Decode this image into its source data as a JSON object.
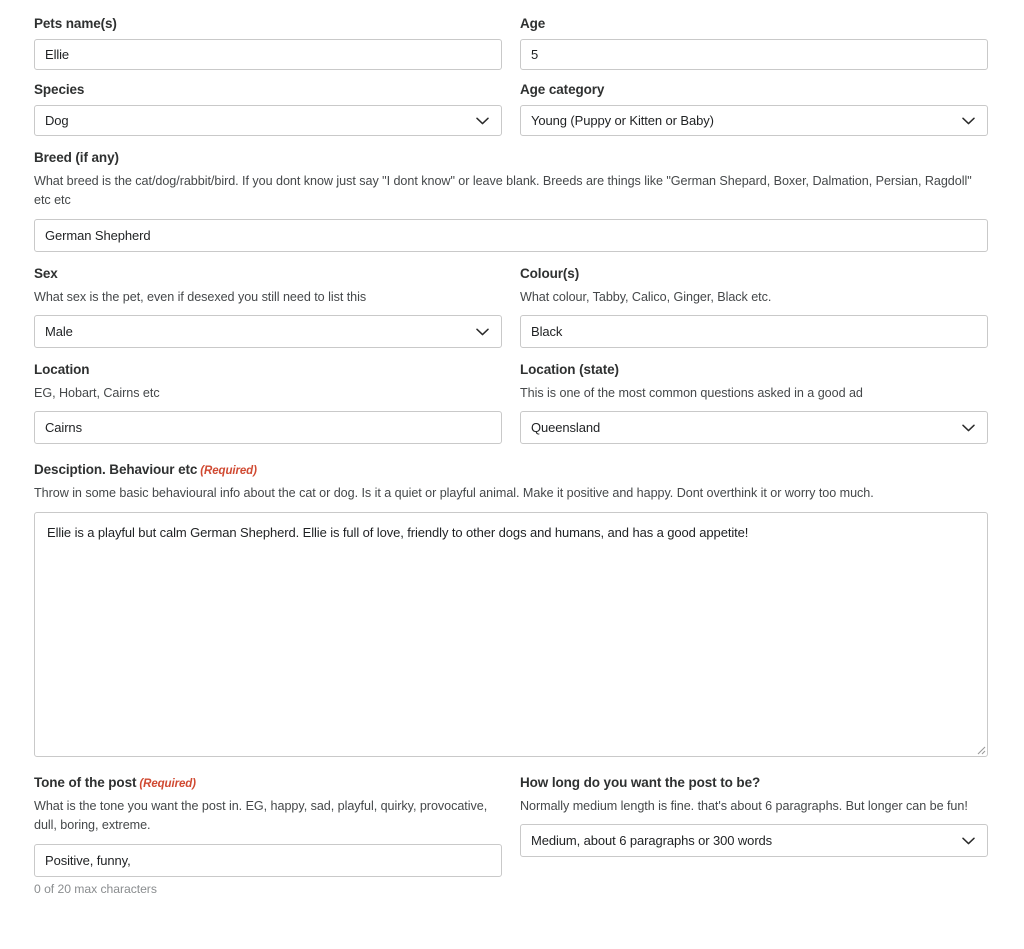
{
  "colors": {
    "required_red": "#d04a32",
    "border": "#c9c9c9",
    "label": "#2f3131",
    "help": "#45484a",
    "counter": "#8a8d8f"
  },
  "form": {
    "pet_name": {
      "label": "Pets name(s)",
      "value": "Ellie"
    },
    "age": {
      "label": "Age",
      "value": "5"
    },
    "species": {
      "label": "Species",
      "value": "Dog"
    },
    "age_category": {
      "label": "Age category",
      "value": "Young (Puppy or Kitten or Baby)"
    },
    "breed": {
      "label": "Breed (if any)",
      "help": "What breed is the cat/dog/rabbit/bird. If you dont know just say \"I dont know\" or leave blank. Breeds are things like \"German Shepard, Boxer, Dalmation, Persian, Ragdoll\" etc etc",
      "value": "German Shepherd"
    },
    "sex": {
      "label": "Sex",
      "help": "What sex is the pet, even if desexed you still need to list this",
      "value": "Male"
    },
    "colour": {
      "label": "Colour(s)",
      "help": "What colour, Tabby, Calico, Ginger, Black etc.",
      "value": "Black"
    },
    "location": {
      "label": "Location",
      "help": "EG, Hobart, Cairns etc",
      "value": "Cairns"
    },
    "location_state": {
      "label": "Location (state)",
      "help": "This is one of the most common questions asked in a good ad",
      "value": "Queensland"
    },
    "description": {
      "label": "Desciption. Behaviour etc",
      "required_marker": "(Required)",
      "help": "Throw in some basic behavioural info about the cat or dog. Is it a quiet or playful animal. Make it positive and happy. Dont overthink it or worry too much.",
      "value": "Ellie is a playful but calm German Shepherd. Ellie is full of love, friendly to other dogs and humans, and has a good appetite!"
    },
    "tone": {
      "label": "Tone of the post",
      "required_marker": "(Required)",
      "help": "What is the tone you want the post in. EG, happy, sad, playful, quirky, provocative, dull, boring, extreme.",
      "value": "Positive, funny,",
      "counter": "0 of 20 max characters"
    },
    "post_length": {
      "label": "How long do you want the post to be?",
      "help": "Normally medium length is fine. that's about 6 paragraphs. But longer can be fun!",
      "value": "Medium, about 6 paragraphs or 300 words"
    }
  }
}
